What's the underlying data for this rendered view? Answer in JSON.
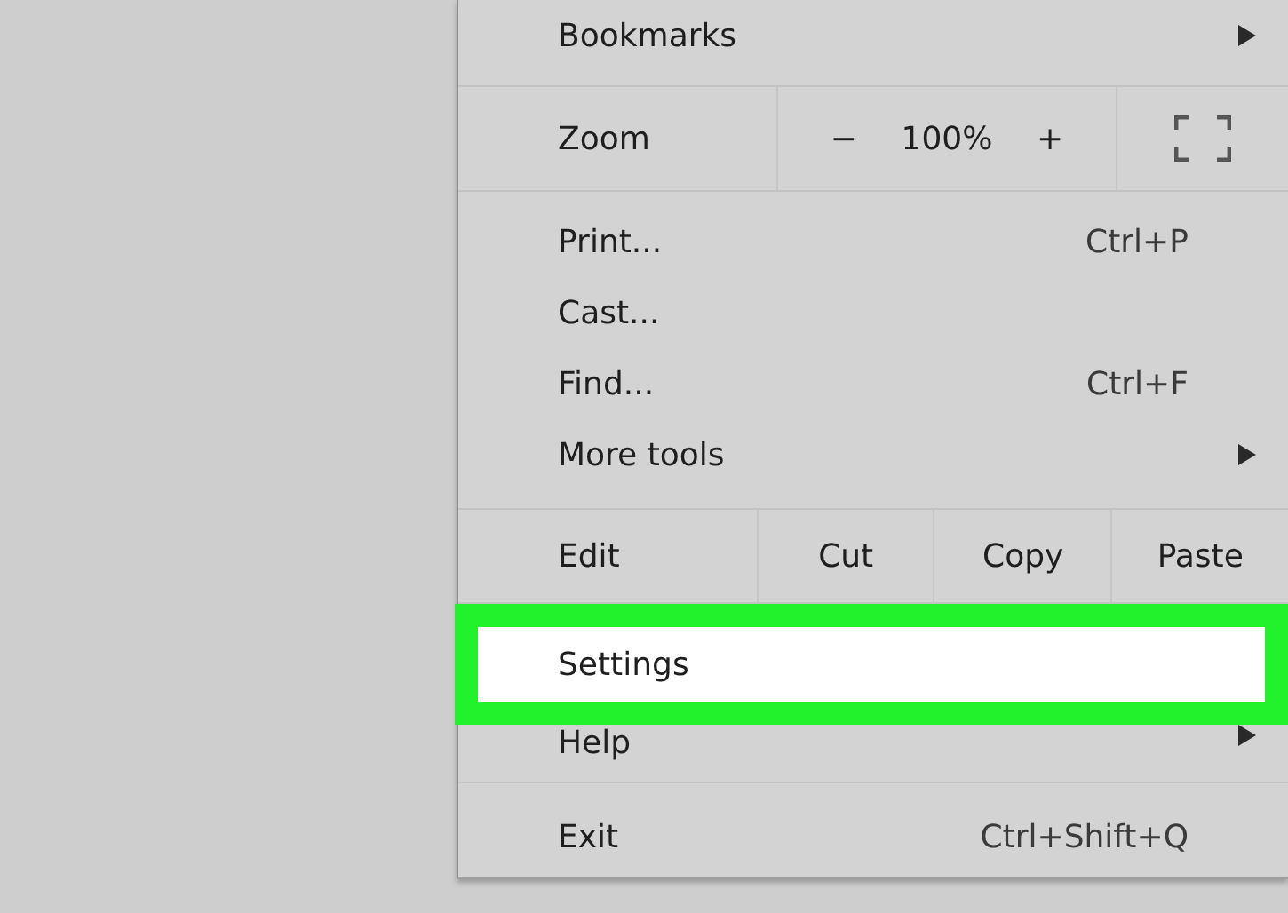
{
  "menu": {
    "sections": [
      {
        "items": [
          {
            "kind": "submenu",
            "label": "Bookmarks",
            "highlighted": false
          }
        ]
      },
      {
        "items": [
          {
            "kind": "zoom",
            "label": "Zoom",
            "minus": "−",
            "value": "100%",
            "plus": "+"
          }
        ]
      },
      {
        "items": [
          {
            "kind": "item",
            "label": "Print...",
            "shortcut": "Ctrl+P",
            "highlighted": false
          },
          {
            "kind": "item",
            "label": "Cast...",
            "highlighted": false
          },
          {
            "kind": "item",
            "label": "Find...",
            "shortcut": "Ctrl+F",
            "highlighted": false
          },
          {
            "kind": "submenu",
            "label": "More tools",
            "highlighted": false
          }
        ]
      },
      {
        "items": [
          {
            "kind": "edit",
            "label": "Edit",
            "actions": [
              "Cut",
              "Copy",
              "Paste"
            ]
          }
        ]
      },
      {
        "items": [
          {
            "kind": "item",
            "label": "Settings",
            "highlighted": true
          },
          {
            "kind": "submenu",
            "label": "Help",
            "highlighted": false
          }
        ]
      },
      {
        "items": [
          {
            "kind": "item",
            "label": "Exit",
            "shortcut": "Ctrl+Shift+Q",
            "highlighted": false
          }
        ]
      }
    ]
  }
}
